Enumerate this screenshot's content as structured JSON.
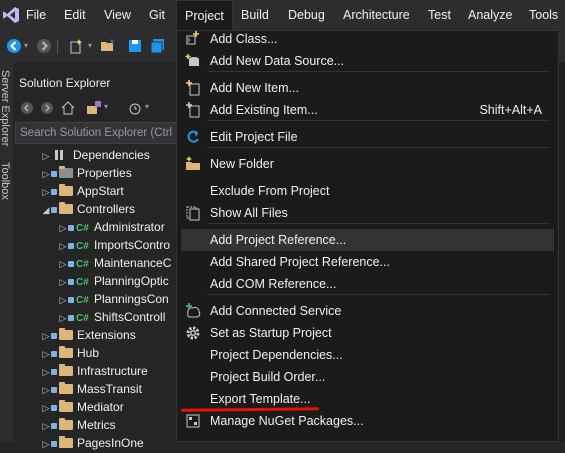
{
  "menubar": {
    "items": [
      {
        "label": "File"
      },
      {
        "label": "Edit"
      },
      {
        "label": "View"
      },
      {
        "label": "Git"
      },
      {
        "label": "Project"
      },
      {
        "label": "Build"
      },
      {
        "label": "Debug"
      },
      {
        "label": "Architecture"
      },
      {
        "label": "Test"
      },
      {
        "label": "Analyze"
      },
      {
        "label": "Tools"
      }
    ],
    "open_item": "Project"
  },
  "side_strip": {
    "labels": [
      "Server Explorer",
      "Toolbox"
    ]
  },
  "solution_explorer": {
    "title": "Solution Explorer",
    "search_placeholder": "Search Solution Explorer (Ctrl",
    "tree": [
      {
        "label": "Dependencies",
        "kind": "dependencies",
        "expanded": false
      },
      {
        "label": "Properties",
        "kind": "properties",
        "expanded": false
      },
      {
        "label": "AppStart",
        "kind": "folder",
        "expanded": false
      },
      {
        "label": "Controllers",
        "kind": "folder",
        "expanded": true
      },
      {
        "label": "Administrator",
        "kind": "csharp",
        "expanded": false
      },
      {
        "label": "ImportsContro",
        "kind": "csharp",
        "expanded": false
      },
      {
        "label": "MaintenanceC",
        "kind": "csharp",
        "expanded": false
      },
      {
        "label": "PlanningOptic",
        "kind": "csharp",
        "expanded": false
      },
      {
        "label": "PlanningsCon",
        "kind": "csharp",
        "expanded": false
      },
      {
        "label": "ShiftsControll",
        "kind": "csharp",
        "expanded": false
      },
      {
        "label": "Extensions",
        "kind": "folder",
        "expanded": false
      },
      {
        "label": "Hub",
        "kind": "folder",
        "expanded": false
      },
      {
        "label": "Infrastructure",
        "kind": "folder",
        "expanded": false
      },
      {
        "label": "MassTransit",
        "kind": "folder",
        "expanded": false
      },
      {
        "label": "Mediator",
        "kind": "folder",
        "expanded": false
      },
      {
        "label": "Metrics",
        "kind": "folder",
        "expanded": false
      },
      {
        "label": "PagesInOne",
        "kind": "folder",
        "expanded": false
      }
    ]
  },
  "project_menu": {
    "items": [
      {
        "label": "Add Class...",
        "icon": "add-class-icon",
        "shortcut": ""
      },
      {
        "label": "Add New Data Source...",
        "icon": "data-source-icon",
        "shortcut": ""
      },
      {
        "label": "Add New Item...",
        "icon": "add-new-item-icon",
        "shortcut": ""
      },
      {
        "label": "Add Existing Item...",
        "icon": "add-existing-item-icon",
        "shortcut": "Shift+Alt+A"
      },
      {
        "label": "Edit Project File",
        "icon": "edit-project-file-icon",
        "shortcut": ""
      },
      {
        "label": "New Folder",
        "icon": "new-folder-icon",
        "shortcut": ""
      },
      {
        "label": "Exclude From Project",
        "icon": "",
        "shortcut": ""
      },
      {
        "label": "Show All Files",
        "icon": "show-all-files-icon",
        "shortcut": ""
      },
      {
        "label": "Add Project Reference...",
        "icon": "",
        "shortcut": "",
        "highlighted": true
      },
      {
        "label": "Add Shared Project Reference...",
        "icon": "",
        "shortcut": ""
      },
      {
        "label": "Add COM Reference...",
        "icon": "",
        "shortcut": ""
      },
      {
        "label": "Add Connected Service",
        "icon": "connected-service-icon",
        "shortcut": ""
      },
      {
        "label": "Set as Startup Project",
        "icon": "gear-icon",
        "shortcut": ""
      },
      {
        "label": "Project Dependencies...",
        "icon": "",
        "shortcut": ""
      },
      {
        "label": "Project Build Order...",
        "icon": "",
        "shortcut": ""
      },
      {
        "label": "Export Template...",
        "icon": "",
        "shortcut": "",
        "annotated": true
      },
      {
        "label": "Manage NuGet Packages...",
        "icon": "nuget-icon",
        "shortcut": ""
      }
    ]
  },
  "colors": {
    "menubar_bg": "#2d2d30",
    "menu_bg": "#1b1b1c",
    "highlight_bg": "#333334",
    "annotation_red": "#e51400",
    "folder": "#dcb67a",
    "csharp": "#4ec070"
  }
}
